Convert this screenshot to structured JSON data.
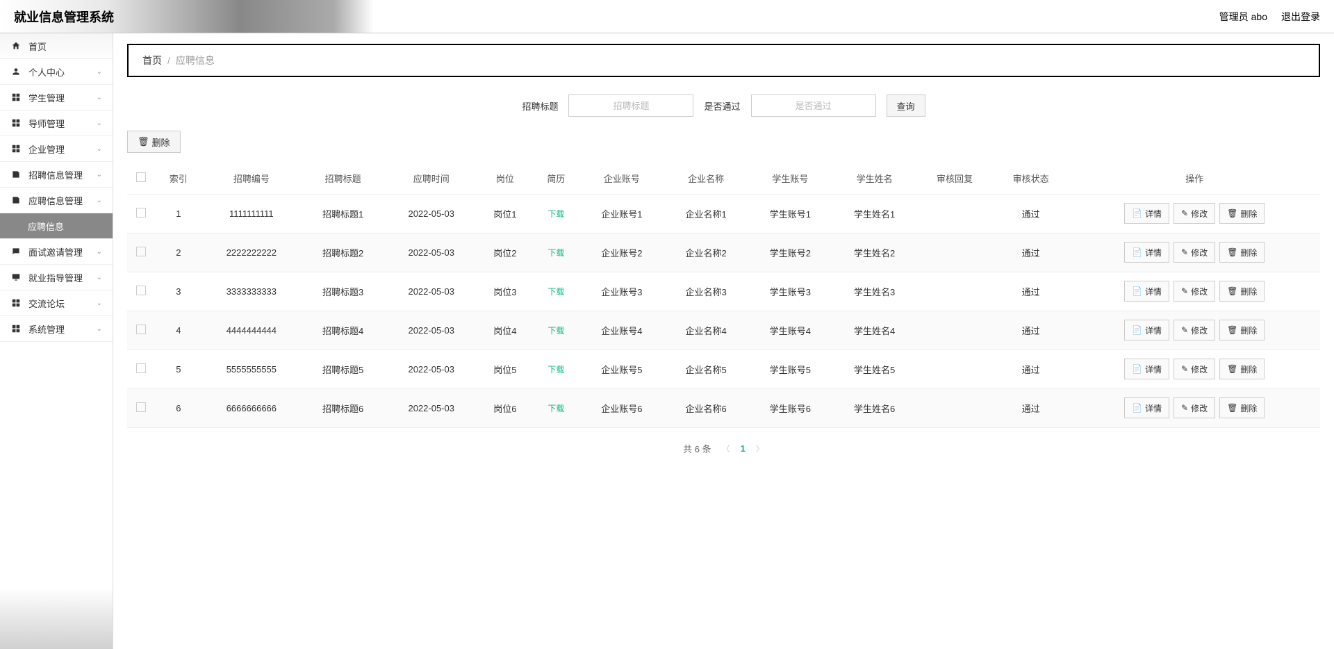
{
  "header": {
    "title": "就业信息管理系统",
    "admin_label": "管理员 abo",
    "logout_label": "退出登录"
  },
  "sidebar": {
    "items": [
      {
        "label": "首页",
        "icon": "home",
        "expandable": false
      },
      {
        "label": "个人中心",
        "icon": "user",
        "expandable": true
      },
      {
        "label": "学生管理",
        "icon": "grid",
        "expandable": true
      },
      {
        "label": "导师管理",
        "icon": "grid",
        "expandable": true
      },
      {
        "label": "企业管理",
        "icon": "grid",
        "expandable": true
      },
      {
        "label": "招聘信息管理",
        "icon": "doc",
        "expandable": true
      },
      {
        "label": "应聘信息管理",
        "icon": "doc",
        "expandable": true,
        "expanded": true
      },
      {
        "label": "应聘信息",
        "icon": "",
        "expandable": false,
        "sub": true,
        "active": true
      },
      {
        "label": "面试邀请管理",
        "icon": "chat",
        "expandable": true
      },
      {
        "label": "就业指导管理",
        "icon": "monitor",
        "expandable": true
      },
      {
        "label": "交流论坛",
        "icon": "grid",
        "expandable": true
      },
      {
        "label": "系统管理",
        "icon": "grid",
        "expandable": true
      }
    ]
  },
  "breadcrumb": {
    "home": "首页",
    "current": "应聘信息"
  },
  "search": {
    "label1": "招聘标题",
    "placeholder1": "招聘标题",
    "label2": "是否通过",
    "placeholder2": "是否通过",
    "query_btn": "查询"
  },
  "toolbar": {
    "delete_btn": "删除"
  },
  "table": {
    "headers": [
      "索引",
      "招聘编号",
      "招聘标题",
      "应聘时间",
      "岗位",
      "简历",
      "企业账号",
      "企业名称",
      "学生账号",
      "学生姓名",
      "审核回复",
      "审核状态",
      "操作"
    ],
    "download_label": "下载",
    "actions": {
      "detail": "详情",
      "edit": "修改",
      "delete": "删除"
    },
    "rows": [
      {
        "idx": "1",
        "code": "1111111111",
        "title": "招聘标题1",
        "date": "2022-05-03",
        "post": "岗位1",
        "ent_acc": "企业账号1",
        "ent_name": "企业名称1",
        "stu_acc": "学生账号1",
        "stu_name": "学生姓名1",
        "reply": "",
        "status": "通过"
      },
      {
        "idx": "2",
        "code": "2222222222",
        "title": "招聘标题2",
        "date": "2022-05-03",
        "post": "岗位2",
        "ent_acc": "企业账号2",
        "ent_name": "企业名称2",
        "stu_acc": "学生账号2",
        "stu_name": "学生姓名2",
        "reply": "",
        "status": "通过"
      },
      {
        "idx": "3",
        "code": "3333333333",
        "title": "招聘标题3",
        "date": "2022-05-03",
        "post": "岗位3",
        "ent_acc": "企业账号3",
        "ent_name": "企业名称3",
        "stu_acc": "学生账号3",
        "stu_name": "学生姓名3",
        "reply": "",
        "status": "通过"
      },
      {
        "idx": "4",
        "code": "4444444444",
        "title": "招聘标题4",
        "date": "2022-05-03",
        "post": "岗位4",
        "ent_acc": "企业账号4",
        "ent_name": "企业名称4",
        "stu_acc": "学生账号4",
        "stu_name": "学生姓名4",
        "reply": "",
        "status": "通过"
      },
      {
        "idx": "5",
        "code": "5555555555",
        "title": "招聘标题5",
        "date": "2022-05-03",
        "post": "岗位5",
        "ent_acc": "企业账号5",
        "ent_name": "企业名称5",
        "stu_acc": "学生账号5",
        "stu_name": "学生姓名5",
        "reply": "",
        "status": "通过"
      },
      {
        "idx": "6",
        "code": "6666666666",
        "title": "招聘标题6",
        "date": "2022-05-03",
        "post": "岗位6",
        "ent_acc": "企业账号6",
        "ent_name": "企业名称6",
        "stu_acc": "学生账号6",
        "stu_name": "学生姓名6",
        "reply": "",
        "status": "通过"
      }
    ]
  },
  "pagination": {
    "total_label": "共 6 条",
    "current_page": "1"
  }
}
